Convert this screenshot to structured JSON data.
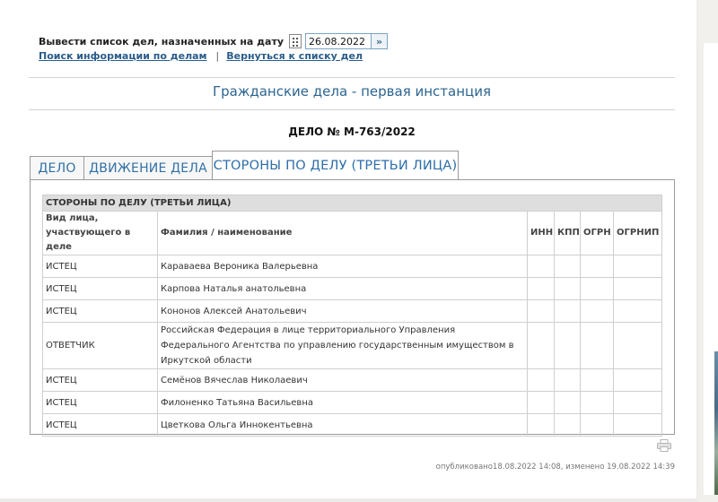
{
  "date_filter": {
    "label": "Вывести список дел, назначенных на дату",
    "date_value": "26.08.2022",
    "calendar_icon": "calendar-icon",
    "go_icon": "double-chevron-icon"
  },
  "links": {
    "search": "Поиск информации по делам",
    "separator": "|",
    "back": "Вернуться к списку дел"
  },
  "section_title": "Гражданские дела - первая инстанция",
  "case_number": "ДЕЛО № М-763/2022",
  "tabs": [
    {
      "label": "ДЕЛО"
    },
    {
      "label": "ДВИЖЕНИЕ ДЕЛА"
    },
    {
      "label": "СТОРОНЫ ПО ДЕЛУ (ТРЕТЬИ ЛИЦА)"
    }
  ],
  "parties_table": {
    "caption": "СТОРОНЫ ПО ДЕЛУ (ТРЕТЬИ ЛИЦА)",
    "columns": [
      "Вид лица, участвующего в деле",
      "Фамилия / наименование",
      "ИНН",
      "КПП",
      "ОГРН",
      "ОГРНИП"
    ],
    "rows": [
      {
        "type": "ИСТЕЦ",
        "name": "Каравaева Вероника Валерьевна"
      },
      {
        "type": "ИСТЕЦ",
        "name": "Карпова Наталья анатольевна"
      },
      {
        "type": "ИСТЕЦ",
        "name": "Кононов Алексей Анатольевич"
      },
      {
        "type": "ОТВЕТЧИК",
        "name": "Российская Федерация в лице территориального Управления Федерального Агентства по управлению государственным имуществом в Иркутской области"
      },
      {
        "type": "ИСТЕЦ",
        "name": "Семёнов Вячеслав Николаевич"
      },
      {
        "type": "ИСТЕЦ",
        "name": "Филоненко Татьяна Васильевна"
      },
      {
        "type": "ИСТЕЦ",
        "name": "Цветкова Ольга Иннокентьевна"
      }
    ]
  },
  "footer": {
    "published": "опубликовано18.08.2022 14:08, изменено 19.08.2022 14:39",
    "print_icon": "printer-icon"
  },
  "colors": {
    "link": "#2a5d8c",
    "title": "#2d6590",
    "tab_text": "#3170a4",
    "caption_bg": "#dedede"
  }
}
